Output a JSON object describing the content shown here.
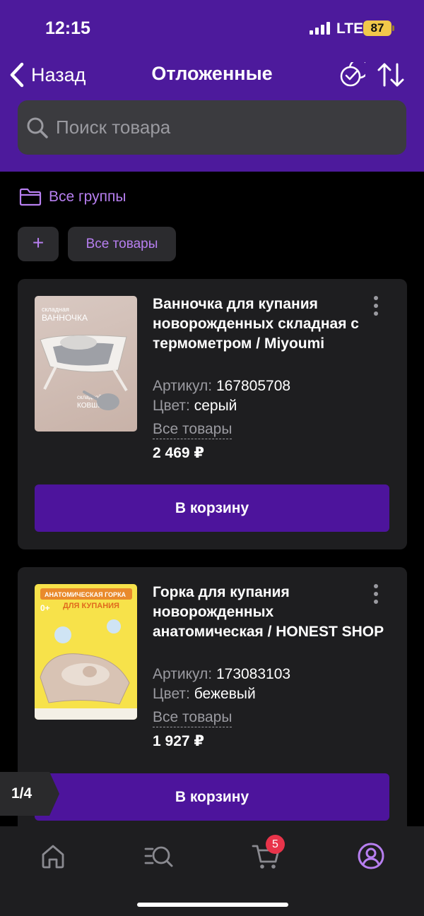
{
  "status_bar": {
    "time": "12:15",
    "network": "LTE",
    "battery": "87"
  },
  "header": {
    "back_label": "Назад",
    "title": "Отложенные"
  },
  "search": {
    "placeholder": "Поиск товара"
  },
  "groups": {
    "label": "Все группы"
  },
  "chips": {
    "add": "+",
    "all": "Все товары"
  },
  "products": [
    {
      "title": "Ванночка для купания новорожденных складная с термометром / Miyoumi",
      "article_label": "Артикул:",
      "article": "167805708",
      "color_label": "Цвет:",
      "color": "серый",
      "group": "Все товары",
      "price": "2 469 ₽",
      "cart_label": "В корзину",
      "image_text": {
        "line1": "складная",
        "line2": "ВАННОЧКА",
        "line3": "складной",
        "line4": "КОВШИК"
      }
    },
    {
      "title": "Горка для купания новорожденных анатомическая / HONEST SHOP",
      "article_label": "Артикул:",
      "article": "173083103",
      "color_label": "Цвет:",
      "color": "бежевый",
      "group": "Все товары",
      "price": "1 927 ₽",
      "cart_label": "В корзину",
      "image_text": {
        "line1": "АНАТОМИЧЕСКАЯ ГОРКА",
        "line2": "ДЛЯ КУПАНИЯ",
        "line3": "0+"
      }
    }
  ],
  "pagination": {
    "label": "1/4"
  },
  "bottom_nav": {
    "cart_badge": "5"
  },
  "colors": {
    "accent": "#4d1a9c",
    "button": "#4d149c",
    "link": "#b77ff0",
    "badge": "#e8344a",
    "card": "#1e1e20"
  }
}
